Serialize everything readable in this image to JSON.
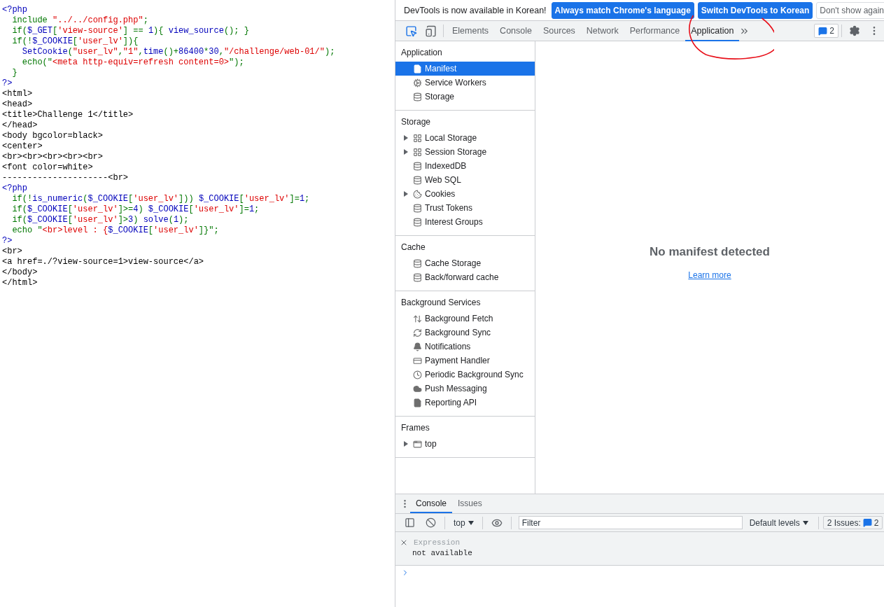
{
  "source_code": {
    "lines": [
      {
        "segments": [
          {
            "text": "<?php",
            "kind": "keyword"
          }
        ]
      },
      {
        "segments": [
          {
            "text": "  include ",
            "kind": "default"
          },
          {
            "text": "\"../../config.php\"",
            "kind": "string"
          },
          {
            "text": ";",
            "kind": "default"
          }
        ]
      },
      {
        "segments": [
          {
            "text": "  if(",
            "kind": "default"
          },
          {
            "text": "$_GET",
            "kind": "keyword"
          },
          {
            "text": "[",
            "kind": "default"
          },
          {
            "text": "'view-source'",
            "kind": "string"
          },
          {
            "text": "] == ",
            "kind": "default"
          },
          {
            "text": "1",
            "kind": "keyword"
          },
          {
            "text": "){ ",
            "kind": "default"
          },
          {
            "text": "view_source",
            "kind": "keyword"
          },
          {
            "text": "(); }",
            "kind": "default"
          }
        ]
      },
      {
        "segments": [
          {
            "text": "  if(!",
            "kind": "default"
          },
          {
            "text": "$_COOKIE",
            "kind": "keyword"
          },
          {
            "text": "[",
            "kind": "default"
          },
          {
            "text": "'user_lv'",
            "kind": "string"
          },
          {
            "text": "]){",
            "kind": "default"
          }
        ]
      },
      {
        "segments": [
          {
            "text": "    SetCookie",
            "kind": "keyword"
          },
          {
            "text": "(",
            "kind": "default"
          },
          {
            "text": "\"user_lv\"",
            "kind": "string"
          },
          {
            "text": ",",
            "kind": "default"
          },
          {
            "text": "\"1\"",
            "kind": "string"
          },
          {
            "text": ",",
            "kind": "default"
          },
          {
            "text": "time",
            "kind": "keyword"
          },
          {
            "text": "()+",
            "kind": "default"
          },
          {
            "text": "86400",
            "kind": "keyword"
          },
          {
            "text": "*",
            "kind": "default"
          },
          {
            "text": "30",
            "kind": "keyword"
          },
          {
            "text": ",",
            "kind": "default"
          },
          {
            "text": "\"/challenge/web-01/\"",
            "kind": "string"
          },
          {
            "text": ");",
            "kind": "default"
          }
        ]
      },
      {
        "segments": [
          {
            "text": "    echo(\"",
            "kind": "default"
          },
          {
            "text": "<meta http-equiv=refresh content=0>",
            "kind": "string"
          },
          {
            "text": "\");",
            "kind": "default"
          }
        ]
      },
      {
        "segments": [
          {
            "text": "  }",
            "kind": "default"
          }
        ]
      },
      {
        "segments": [
          {
            "text": "?>",
            "kind": "keyword"
          }
        ]
      },
      {
        "segments": [
          {
            "text": "<html>",
            "kind": "html"
          }
        ]
      },
      {
        "segments": [
          {
            "text": "<head>",
            "kind": "html"
          }
        ]
      },
      {
        "segments": [
          {
            "text": "<title>Challenge 1</title>",
            "kind": "html"
          }
        ]
      },
      {
        "segments": [
          {
            "text": "</head>",
            "kind": "html"
          }
        ]
      },
      {
        "segments": [
          {
            "text": "<body bgcolor=black>",
            "kind": "html"
          }
        ]
      },
      {
        "segments": [
          {
            "text": "<center>",
            "kind": "html"
          }
        ]
      },
      {
        "segments": [
          {
            "text": "<br><br><br><br><br>",
            "kind": "html"
          }
        ]
      },
      {
        "segments": [
          {
            "text": "<font color=white>",
            "kind": "html"
          }
        ]
      },
      {
        "segments": [
          {
            "text": "---------------------<br>",
            "kind": "html"
          }
        ]
      },
      {
        "segments": [
          {
            "text": "<?php",
            "kind": "keyword"
          }
        ]
      },
      {
        "segments": [
          {
            "text": "  if(!",
            "kind": "default"
          },
          {
            "text": "is_numeric",
            "kind": "keyword"
          },
          {
            "text": "(",
            "kind": "default"
          },
          {
            "text": "$_COOKIE",
            "kind": "keyword"
          },
          {
            "text": "[",
            "kind": "default"
          },
          {
            "text": "'user_lv'",
            "kind": "string"
          },
          {
            "text": "])) ",
            "kind": "default"
          },
          {
            "text": "$_COOKIE",
            "kind": "keyword"
          },
          {
            "text": "[",
            "kind": "default"
          },
          {
            "text": "'user_lv'",
            "kind": "string"
          },
          {
            "text": "]=",
            "kind": "default"
          },
          {
            "text": "1",
            "kind": "keyword"
          },
          {
            "text": ";",
            "kind": "default"
          }
        ]
      },
      {
        "segments": [
          {
            "text": "  if(",
            "kind": "default"
          },
          {
            "text": "$_COOKIE",
            "kind": "keyword"
          },
          {
            "text": "[",
            "kind": "default"
          },
          {
            "text": "'user_lv'",
            "kind": "string"
          },
          {
            "text": "]>=",
            "kind": "default"
          },
          {
            "text": "4",
            "kind": "keyword"
          },
          {
            "text": ") ",
            "kind": "default"
          },
          {
            "text": "$_COOKIE",
            "kind": "keyword"
          },
          {
            "text": "[",
            "kind": "default"
          },
          {
            "text": "'user_lv'",
            "kind": "string"
          },
          {
            "text": "]=",
            "kind": "default"
          },
          {
            "text": "1",
            "kind": "keyword"
          },
          {
            "text": ";",
            "kind": "default"
          }
        ]
      },
      {
        "segments": [
          {
            "text": "  if(",
            "kind": "default"
          },
          {
            "text": "$_COOKIE",
            "kind": "keyword"
          },
          {
            "text": "[",
            "kind": "default"
          },
          {
            "text": "'user_lv'",
            "kind": "string"
          },
          {
            "text": "]>",
            "kind": "default"
          },
          {
            "text": "3",
            "kind": "keyword"
          },
          {
            "text": ") ",
            "kind": "default"
          },
          {
            "text": "solve",
            "kind": "keyword"
          },
          {
            "text": "(",
            "kind": "default"
          },
          {
            "text": "1",
            "kind": "keyword"
          },
          {
            "text": ");",
            "kind": "default"
          }
        ]
      },
      {
        "segments": [
          {
            "text": "  echo \"",
            "kind": "default"
          },
          {
            "text": "<br>level : {",
            "kind": "string"
          },
          {
            "text": "$_COOKIE",
            "kind": "keyword"
          },
          {
            "text": "[",
            "kind": "default"
          },
          {
            "text": "'user_lv'",
            "kind": "string"
          },
          {
            "text": "]}\";",
            "kind": "default"
          }
        ]
      },
      {
        "segments": [
          {
            "text": "?>",
            "kind": "keyword"
          }
        ]
      },
      {
        "segments": [
          {
            "text": "<br>",
            "kind": "html"
          }
        ]
      },
      {
        "segments": [
          {
            "text": "<a href=./?view-source=1>view-source</a>",
            "kind": "html"
          }
        ]
      },
      {
        "segments": [
          {
            "text": "</body>",
            "kind": "html"
          }
        ]
      },
      {
        "segments": [
          {
            "text": "</html>",
            "kind": "html"
          }
        ]
      }
    ]
  },
  "devtools": {
    "infobar": {
      "message": "DevTools is now available in Korean!",
      "buttons": [
        {
          "label": "Always match Chrome's language",
          "kind": "primary"
        },
        {
          "label": "Switch DevTools to Korean",
          "kind": "primary"
        },
        {
          "label": "Don't show again",
          "kind": "secondary"
        }
      ]
    },
    "tabs": [
      {
        "label": "Elements",
        "selected": false
      },
      {
        "label": "Console",
        "selected": false
      },
      {
        "label": "Sources",
        "selected": false
      },
      {
        "label": "Network",
        "selected": false
      },
      {
        "label": "Performance",
        "selected": false
      },
      {
        "label": "Application",
        "selected": true
      }
    ],
    "issues_badge": "2",
    "sidebar": {
      "sections": [
        {
          "title": "Application",
          "items": [
            {
              "label": "Manifest",
              "kind": "file",
              "expandable": false,
              "selected": true
            },
            {
              "label": "Service Workers",
              "kind": "gear",
              "expandable": false,
              "selected": false
            },
            {
              "label": "Storage",
              "kind": "database",
              "expandable": false,
              "selected": false
            }
          ]
        },
        {
          "title": "Storage",
          "items": [
            {
              "label": "Local Storage",
              "kind": "grid",
              "expandable": true,
              "selected": false
            },
            {
              "label": "Session Storage",
              "kind": "grid",
              "expandable": true,
              "selected": false
            },
            {
              "label": "IndexedDB",
              "kind": "database",
              "expandable": false,
              "selected": false
            },
            {
              "label": "Web SQL",
              "kind": "database",
              "expandable": false,
              "selected": false
            },
            {
              "label": "Cookies",
              "kind": "cookie",
              "expandable": true,
              "selected": false
            },
            {
              "label": "Trust Tokens",
              "kind": "database",
              "expandable": false,
              "selected": false
            },
            {
              "label": "Interest Groups",
              "kind": "database",
              "expandable": false,
              "selected": false
            }
          ]
        },
        {
          "title": "Cache",
          "items": [
            {
              "label": "Cache Storage",
              "kind": "database",
              "expandable": false,
              "selected": false
            },
            {
              "label": "Back/forward cache",
              "kind": "database",
              "expandable": false,
              "selected": false
            }
          ]
        },
        {
          "title": "Background Services",
          "items": [
            {
              "label": "Background Fetch",
              "kind": "arrows",
              "expandable": false,
              "selected": false
            },
            {
              "label": "Background Sync",
              "kind": "sync",
              "expandable": false,
              "selected": false
            },
            {
              "label": "Notifications",
              "kind": "bell",
              "expandable": false,
              "selected": false
            },
            {
              "label": "Payment Handler",
              "kind": "card",
              "expandable": false,
              "selected": false
            },
            {
              "label": "Periodic Background Sync",
              "kind": "clock",
              "expandable": false,
              "selected": false
            },
            {
              "label": "Push Messaging",
              "kind": "cloud",
              "expandable": false,
              "selected": false
            },
            {
              "label": "Reporting API",
              "kind": "file",
              "expandable": false,
              "selected": false
            }
          ]
        },
        {
          "title": "Frames",
          "items": [
            {
              "label": "top",
              "kind": "frame",
              "expandable": true,
              "selected": false
            }
          ]
        }
      ]
    },
    "main": {
      "heading": "No manifest detected",
      "link": "Learn more"
    },
    "drawer": {
      "tabs": [
        {
          "label": "Console",
          "selected": true
        },
        {
          "label": "Issues",
          "selected": false
        }
      ],
      "context": "top",
      "filter_placeholder": "Filter",
      "levels": "Default levels",
      "issues_label": "2 Issues:",
      "issues_count": "2",
      "expression": {
        "label": "Expression",
        "value": "not available"
      }
    }
  }
}
